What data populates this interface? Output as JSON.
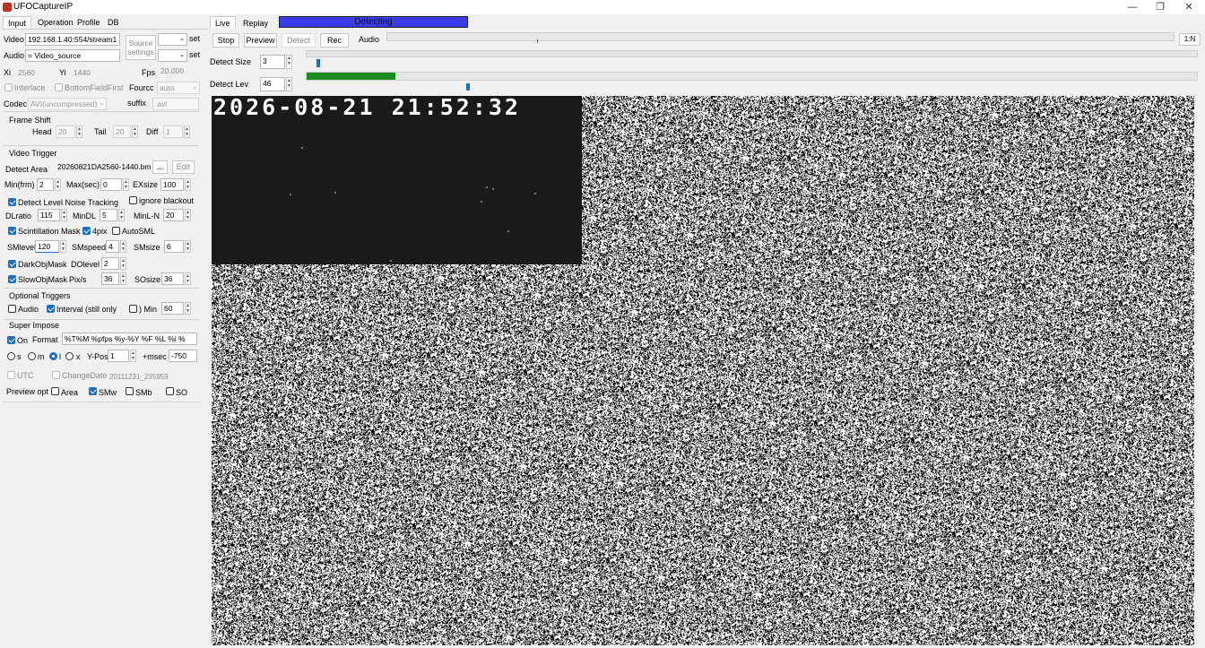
{
  "app": {
    "title": "UFOCaptureIP",
    "title_icon": "ufo-app-icon"
  },
  "window_controls": {
    "minimize": "—",
    "maximize": "❐",
    "close": "✕"
  },
  "left_tabs": [
    "Input",
    "Operation",
    "Profile",
    "DB"
  ],
  "input": {
    "video_label": "Video",
    "video_value": "192.168.1.40:554/stream1",
    "audio_label": "Audio",
    "audio_value": "= Video_source",
    "source_settings": "Source settings",
    "set": "set",
    "xi_label": "Xi",
    "xi_value": "2560",
    "yi_label": "Yi",
    "yi_value": "1440",
    "fps_label": "Fps",
    "fps_value": "20.000",
    "interlace": "Interlace",
    "bottom_field_first": "BottomFieldFirst",
    "fourcc_label": "Fourcc",
    "fourcc_value": "auto",
    "codec_label": "Codec",
    "codec_value": "AVI(uncompressed)",
    "suffix_label": "suffix",
    "suffix_value": ".avi"
  },
  "frame_shift": {
    "title": "Frame Shift",
    "head_label": "Head",
    "head_value": "20",
    "tail_label": "Tail",
    "tail_value": "20",
    "diff_label": "Diff",
    "diff_value": "1"
  },
  "video_trigger": {
    "title": "Video Trigger",
    "detect_area_label": "Detect Area",
    "detect_area_value": "20260821DA2560-1440.bmp",
    "browse": "...",
    "edit": "Edit",
    "min_frm_label": "Min(frm)",
    "min_frm_value": "2",
    "max_sec_label": "Max(sec)",
    "max_sec_value": "0",
    "exsize_label": "EXsize",
    "exsize_value": "100",
    "detect_level_noise": "Detect Level Noise Tracking",
    "ignore_blackout": "ignore blackout",
    "dratio_label": "DLratio",
    "dratio_value": "115",
    "mindl_label": "MinDL",
    "mindl_value": "5",
    "minln_label": "MinL-N",
    "minln_value": "20",
    "scintillation_mask": "Scintillation Mask",
    "fourpix": "4pix",
    "autosml": "AutoSML",
    "smlevel_label": "SMlevel",
    "smlevel_value": "120",
    "smspeed_label": "SMspeed",
    "smspeed_value": "4",
    "smsize_label": "SMsize",
    "smsize_value": "6",
    "darkobjmask": "DarkObjMask",
    "dolevel_label": "DOlevel",
    "dolevel_value": "2",
    "slowobjmask": "SlowObjMask",
    "pixs_label": "Pix/s",
    "pixs_value": "36",
    "sosize_label": "SOsize",
    "sosize_value": "36"
  },
  "optional_triggers": {
    "title": "Optional Triggers",
    "audio": "Audio",
    "interval": "Interval (still only",
    "min_suffix": ") Min",
    "min_value": "60"
  },
  "super_impose": {
    "title": "Super Impose",
    "on": "On",
    "format_label": "Format",
    "format_value": "%T%M         %pfps %y-%Y %F %L  %i %",
    "s": "s",
    "m": "m",
    "l": "l",
    "x": "x",
    "ypos_label": "Y-Pos",
    "ypos_value": "1",
    "msec_label": "+msec",
    "msec_value": "-750",
    "utc": "UTC",
    "change_date": "ChangeDate",
    "change_date_value": "20111231_235959"
  },
  "preview_opt": {
    "label": "Preview opt",
    "area": "Area",
    "smw": "SMw",
    "smb": "SMb",
    "so": "SO"
  },
  "right_tabs": [
    "Live",
    "Replay"
  ],
  "status": {
    "text": "Detecting",
    "color": "#3a3ae6"
  },
  "toolbar": {
    "stop": "Stop",
    "preview": "Preview",
    "detect": "Detect",
    "rec": "Rec",
    "audio": "Audio",
    "ratio": "1:N"
  },
  "detect_size": {
    "label": "Detect Size",
    "value": "3",
    "level": 0.01
  },
  "detect_lev": {
    "label": "Detect Lev",
    "value": "46",
    "level": 0.1,
    "bar_color": "#1e8c1e",
    "marker": 0.18
  },
  "audio_level": 0.19,
  "video": {
    "timestamp": "2026-08-21 21:52:32"
  }
}
